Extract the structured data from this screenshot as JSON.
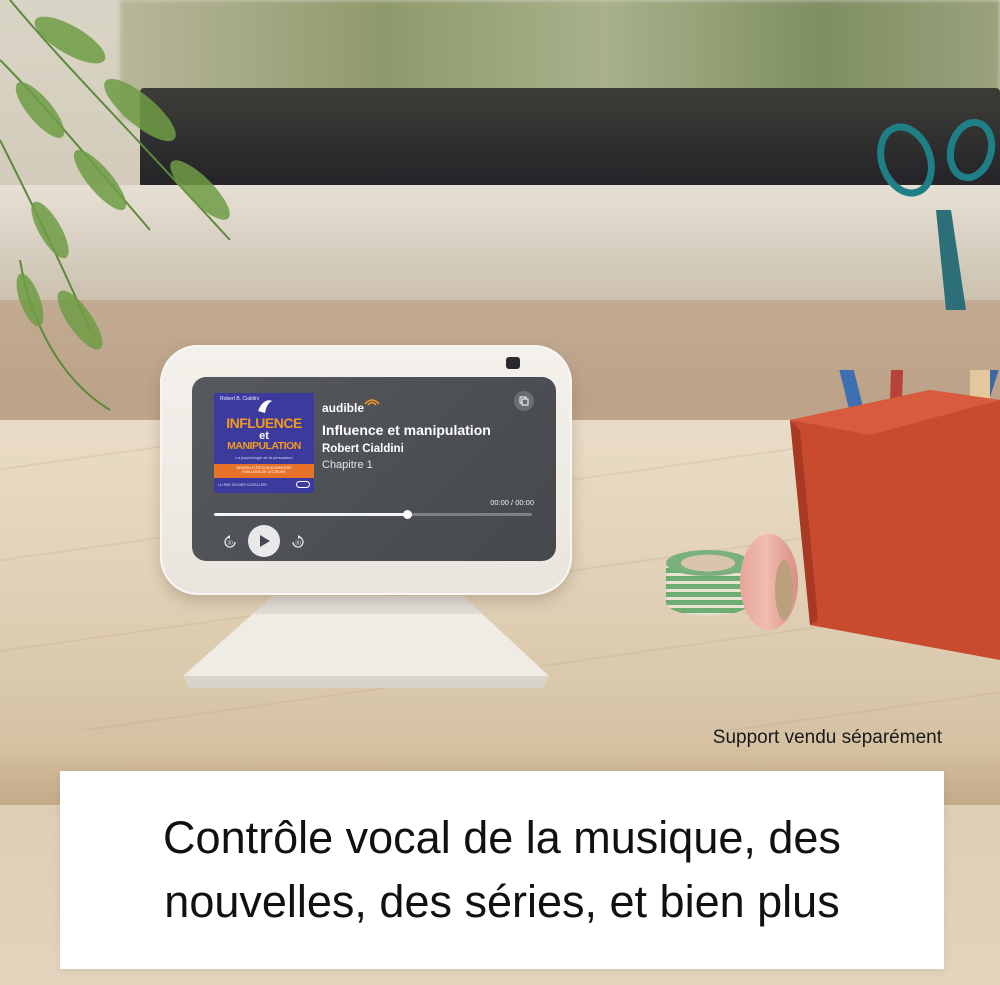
{
  "player": {
    "app_logo": "audible",
    "title": "Influence et manipulation",
    "author": "Robert Cialdini",
    "chapter": "Chapitre 1",
    "time": "00:00 / 00:00",
    "progress": 0.61,
    "buttons": {
      "rewind_icon": "rewind-30-icon",
      "play_icon": "play-icon",
      "forward_icon": "forward-30-icon",
      "cast_icon": "cast-icon"
    }
  },
  "cover": {
    "author_line": "Robert B. Cialdini",
    "title_line1": "INFLUENCE",
    "title_line2": "et",
    "title_line3": "MANIPULATION",
    "subtitle": "La psychologie de la persuasion",
    "band_line1": "NOUVELLE ÉDITION AUGMENTÉE",
    "band_line2": "5 MILLIONS DE LECTEURS",
    "footer": "LU PAR OLIVIER CUVELLIER",
    "colors": {
      "background": "#3d3a9e",
      "accent": "#f39a1d",
      "band": "#e8722a"
    }
  },
  "caption": "Support vendu séparément",
  "banner": {
    "line1": "Contrôle vocal de la musique, des",
    "line2": "nouvelles, des séries, et bien plus"
  }
}
